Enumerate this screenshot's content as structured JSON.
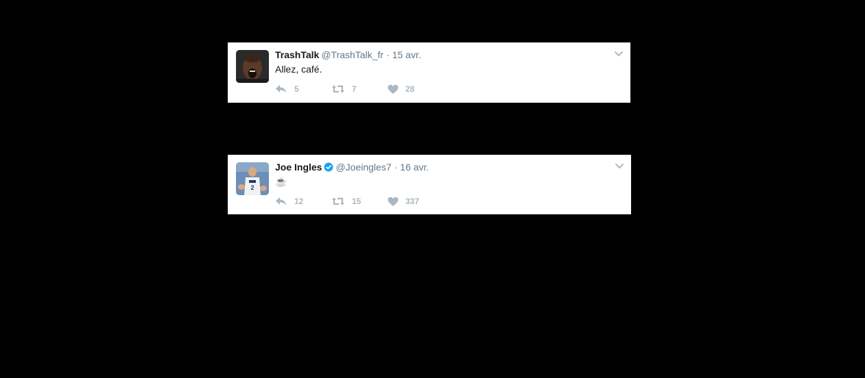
{
  "tweets": [
    {
      "name": "TrashTalk",
      "handle": "@TrashTalk_fr",
      "separator": "·",
      "date": "15 avr.",
      "verified": false,
      "text": "Allez, café.",
      "replies": "5",
      "retweets": "7",
      "likes": "28",
      "avatar_icon": "player-shouting-avatar"
    },
    {
      "name": "Joe Ingles",
      "handle": "@Joeingles7",
      "separator": "·",
      "date": "16 avr.",
      "verified": true,
      "text": "☕",
      "replies": "12",
      "retweets": "15",
      "likes": "337",
      "avatar_icon": "basketball-player-avatar"
    }
  ],
  "colors": {
    "background": "#000000",
    "card": "#ffffff",
    "name": "#14171a",
    "meta": "#657786",
    "action": "#aab8c2",
    "verified": "#1da1f2"
  },
  "icons": {
    "reply": "reply-icon",
    "retweet": "retweet-icon",
    "like": "heart-icon",
    "menu": "chevron-down-icon",
    "verified": "verified-badge-icon"
  }
}
